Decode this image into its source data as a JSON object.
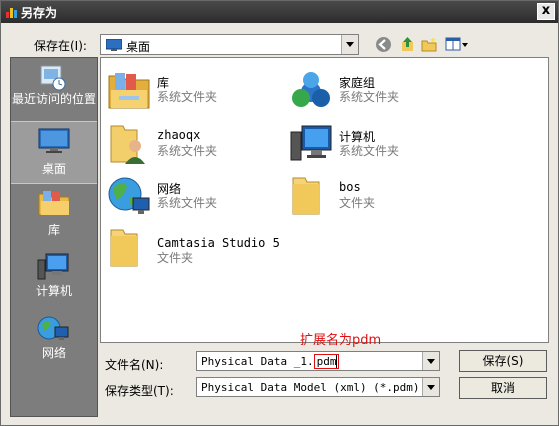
{
  "window": {
    "title": "另存为",
    "close_label": "x"
  },
  "save_in": {
    "label": "保存在(I):",
    "value": "桌面"
  },
  "places": [
    {
      "label": "最近访问的位置"
    },
    {
      "label": "桌面"
    },
    {
      "label": "库"
    },
    {
      "label": "计算机"
    },
    {
      "label": "网络"
    }
  ],
  "files": [
    {
      "name": "库",
      "type": "系统文件夹"
    },
    {
      "name": "家庭组",
      "type": "系统文件夹"
    },
    {
      "name": "zhaoqx",
      "type": "系统文件夹"
    },
    {
      "name": "计算机",
      "type": "系统文件夹"
    },
    {
      "name": "网络",
      "type": "系统文件夹"
    },
    {
      "name": "bos",
      "type": "文件夹"
    },
    {
      "name": "Camtasia Studio 5",
      "type": "文件夹"
    }
  ],
  "filename": {
    "label": "文件名(N):",
    "value_prefix": "Physical Data _1.",
    "value_ext": "pdm"
  },
  "filetype": {
    "label": "保存类型(T):",
    "value": "Physical Data Model (xml) (*.pdm)"
  },
  "buttons": {
    "save": "保存(S)",
    "cancel": "取消"
  },
  "annotation": {
    "text": "扩展名为pdm",
    "color": "#e01010"
  }
}
